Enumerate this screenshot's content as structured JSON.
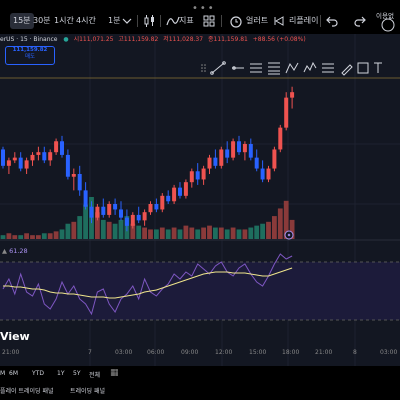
{
  "toolbar": {
    "timeframes": [
      "15분",
      "30분",
      "1시간",
      "4시간",
      "1분"
    ],
    "active_timeframe": "15분",
    "indicators_label": "지표",
    "alerts_label": "얼러트",
    "replay_label": "리플레이",
    "right_cut_label": "이용없"
  },
  "legend": {
    "symbol": "erUS · 15 · Binance",
    "open": "시111,071.25",
    "high": "고111,159.82",
    "low": "저111,028.37",
    "close": "종111,159.81",
    "change": "+88.56 (+0.08%)"
  },
  "price_box": {
    "price": "111,159.82",
    "label": "매도"
  },
  "chart_data": [
    {
      "type": "candlestick",
      "title": "",
      "candles": [
        {
          "o": 31,
          "h": 32,
          "l": 24,
          "c": 25
        },
        {
          "o": 25,
          "h": 28,
          "l": 22,
          "c": 27
        },
        {
          "o": 27,
          "h": 30,
          "l": 26,
          "c": 28
        },
        {
          "o": 28,
          "h": 30,
          "l": 23,
          "c": 24
        },
        {
          "o": 24,
          "h": 28,
          "l": 22,
          "c": 27
        },
        {
          "o": 27,
          "h": 30,
          "l": 25,
          "c": 29
        },
        {
          "o": 29,
          "h": 32,
          "l": 27,
          "c": 30
        },
        {
          "o": 30,
          "h": 32,
          "l": 26,
          "c": 27
        },
        {
          "o": 27,
          "h": 31,
          "l": 25,
          "c": 30
        },
        {
          "o": 30,
          "h": 35,
          "l": 29,
          "c": 34
        },
        {
          "o": 34,
          "h": 36,
          "l": 28,
          "c": 29
        },
        {
          "o": 29,
          "h": 31,
          "l": 20,
          "c": 21
        },
        {
          "o": 21,
          "h": 24,
          "l": 16,
          "c": 22
        },
        {
          "o": 22,
          "h": 25,
          "l": 14,
          "c": 16
        },
        {
          "o": 16,
          "h": 19,
          "l": 9,
          "c": 10
        },
        {
          "o": 10,
          "h": 12,
          "l": 4,
          "c": 6
        },
        {
          "o": 6,
          "h": 11,
          "l": 5,
          "c": 10
        },
        {
          "o": 10,
          "h": 13,
          "l": 6,
          "c": 7
        },
        {
          "o": 7,
          "h": 12,
          "l": 6,
          "c": 11
        },
        {
          "o": 11,
          "h": 13,
          "l": 7,
          "c": 9
        },
        {
          "o": 9,
          "h": 12,
          "l": 5,
          "c": 6
        },
        {
          "o": 6,
          "h": 9,
          "l": 1,
          "c": 3
        },
        {
          "o": 3,
          "h": 8,
          "l": 2,
          "c": 7
        },
        {
          "o": 7,
          "h": 10,
          "l": 4,
          "c": 5
        },
        {
          "o": 5,
          "h": 9,
          "l": 3,
          "c": 8
        },
        {
          "o": 8,
          "h": 12,
          "l": 7,
          "c": 11
        },
        {
          "o": 11,
          "h": 13,
          "l": 8,
          "c": 9
        },
        {
          "o": 9,
          "h": 15,
          "l": 8,
          "c": 14
        },
        {
          "o": 14,
          "h": 16,
          "l": 11,
          "c": 12
        },
        {
          "o": 12,
          "h": 18,
          "l": 11,
          "c": 17
        },
        {
          "o": 17,
          "h": 19,
          "l": 13,
          "c": 14
        },
        {
          "o": 14,
          "h": 20,
          "l": 13,
          "c": 19
        },
        {
          "o": 19,
          "h": 24,
          "l": 17,
          "c": 23
        },
        {
          "o": 23,
          "h": 26,
          "l": 18,
          "c": 20
        },
        {
          "o": 20,
          "h": 25,
          "l": 18,
          "c": 24
        },
        {
          "o": 24,
          "h": 29,
          "l": 22,
          "c": 28
        },
        {
          "o": 28,
          "h": 31,
          "l": 24,
          "c": 25
        },
        {
          "o": 25,
          "h": 32,
          "l": 24,
          "c": 31
        },
        {
          "o": 31,
          "h": 34,
          "l": 26,
          "c": 28
        },
        {
          "o": 28,
          "h": 35,
          "l": 27,
          "c": 34
        },
        {
          "o": 34,
          "h": 36,
          "l": 29,
          "c": 30
        },
        {
          "o": 30,
          "h": 34,
          "l": 27,
          "c": 33
        },
        {
          "o": 33,
          "h": 35,
          "l": 27,
          "c": 28
        },
        {
          "o": 28,
          "h": 31,
          "l": 23,
          "c": 24
        },
        {
          "o": 24,
          "h": 27,
          "l": 19,
          "c": 20
        },
        {
          "o": 20,
          "h": 25,
          "l": 19,
          "c": 24
        },
        {
          "o": 24,
          "h": 32,
          "l": 23,
          "c": 31
        },
        {
          "o": 31,
          "h": 40,
          "l": 30,
          "c": 39
        },
        {
          "o": 39,
          "h": 52,
          "l": 38,
          "c": 50
        },
        {
          "o": 50,
          "h": 54,
          "l": 46,
          "c": 52
        }
      ],
      "volumes": [
        2,
        3,
        2,
        2,
        3,
        2,
        2,
        3,
        3,
        4,
        5,
        8,
        9,
        12,
        18,
        22,
        14,
        10,
        9,
        8,
        10,
        12,
        8,
        7,
        6,
        5,
        5,
        6,
        5,
        6,
        5,
        7,
        6,
        5,
        6,
        7,
        6,
        6,
        5,
        6,
        5,
        5,
        6,
        7,
        8,
        9,
        12,
        16,
        20,
        10
      ],
      "bullish_color": "#ef5350",
      "bearish_color": "#2962ff",
      "volume_bull_color": "#8a3a3a",
      "volume_bear_color": "#1e6e5e"
    },
    {
      "type": "line",
      "title": "",
      "series": [
        {
          "values": [
            45,
            55,
            40,
            60,
            42,
            38,
            50,
            30,
            25,
            35,
            52,
            40,
            48,
            35,
            30,
            20,
            42,
            45,
            30,
            22,
            35,
            40,
            48,
            35,
            55,
            42,
            38,
            45,
            50,
            60,
            55,
            62,
            58,
            70,
            65,
            60,
            68,
            72,
            62,
            58,
            66,
            70,
            60,
            52,
            48,
            58,
            70,
            80,
            75,
            78
          ]
        },
        {
          "values": [
            48,
            48,
            47,
            47,
            46,
            45,
            45,
            44,
            42,
            41,
            41,
            40,
            40,
            39,
            38,
            37,
            37,
            37,
            36,
            36,
            37,
            38,
            39,
            40,
            42,
            43,
            44,
            46,
            48,
            50,
            52,
            54,
            56,
            58,
            60,
            61,
            62,
            62,
            62,
            61,
            61,
            61,
            60,
            59,
            58,
            58,
            60,
            62,
            64,
            66
          ]
        }
      ],
      "value_label": "61.28",
      "ylim": [
        0,
        100
      ],
      "levels": [
        30,
        70
      ],
      "line_color": "#7e57c2",
      "ma_color": "#f0e68c"
    }
  ],
  "x_axis": {
    "labels": [
      "21:00",
      "7",
      "03:00",
      "06:00",
      "09:00",
      "12:00",
      "15:00",
      "18:00",
      "21:00",
      "8",
      "03:00"
    ]
  },
  "watermark": "View",
  "range_bar": {
    "items": [
      "6M",
      "YTD",
      "1Y",
      "5Y",
      "전체"
    ],
    "left_cut": "M"
  },
  "footer": {
    "left": "플레이 트레이딩 패널",
    "right": "트레이딩 패널"
  }
}
